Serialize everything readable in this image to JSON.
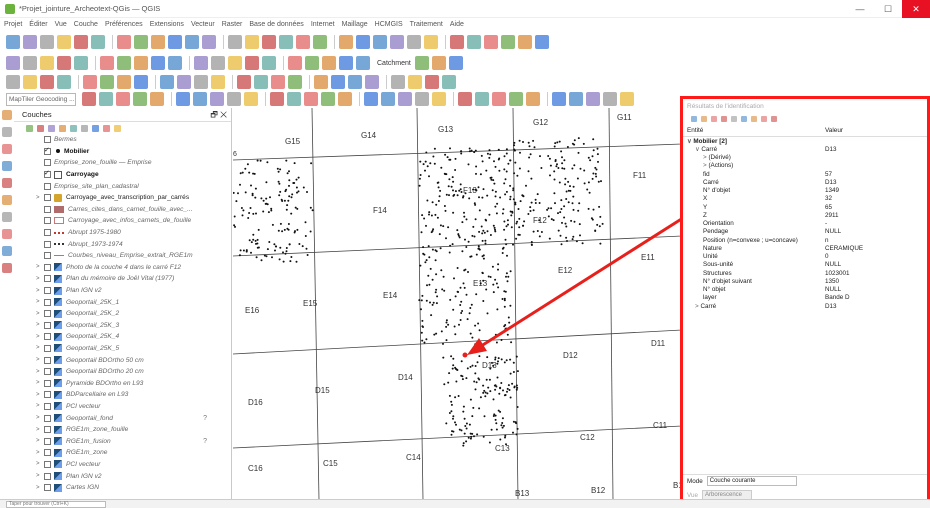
{
  "window": {
    "title": "*Projet_jointure_Archeotext-QGis — QGIS",
    "minimize": "—",
    "maximize": "☐",
    "close": "✕"
  },
  "menu": [
    "Projet",
    "Éditer",
    "Vue",
    "Couche",
    "Préférences",
    "Extensions",
    "Vecteur",
    "Raster",
    "Base de données",
    "Internet",
    "Maillage",
    "HCMGIS",
    "Traitement",
    "Aide"
  ],
  "toolbar": {
    "catchment_label": "Catchment",
    "geocoding_placeholder": "MapTiler Geocoding ..."
  },
  "layers_panel": {
    "title": "Couches",
    "dock_icon": "🗗",
    "close_icon": "✕",
    "items": [
      {
        "name": "Bermes",
        "checked": false,
        "style": "italic",
        "sym": "none"
      },
      {
        "name": "Mobilier",
        "checked": true,
        "style": "bold",
        "sym": "dot"
      },
      {
        "name": "Emprise_zone_fouille — Emprise",
        "checked": false,
        "style": "italic",
        "sym": "none"
      },
      {
        "name": "Carroyage",
        "checked": true,
        "style": "bold",
        "sym": "square"
      },
      {
        "name": "Emprise_site_plan_cadastral",
        "checked": false,
        "style": "italic",
        "sym": "none"
      },
      {
        "name": "Carroyage_avec_transcription_par_carrés",
        "checked": false,
        "style": "plain",
        "sym": "group"
      },
      {
        "name": "Carres_cites_dans_carnet_fouille_avec_...",
        "checked": false,
        "style": "italic",
        "sym": "pink"
      },
      {
        "name": "Carroyage_avec_infos_carnets_de_fouille",
        "checked": false,
        "style": "italic",
        "sym": "salmon"
      },
      {
        "name": "Abrupt 1975-1980",
        "checked": false,
        "style": "italic",
        "sym": "dash"
      },
      {
        "name": "Abrupt_1973-1974",
        "checked": false,
        "style": "italic",
        "sym": "dash2"
      },
      {
        "name": "Courbes_niveau_Emprise_extrait_RGE1m",
        "checked": false,
        "style": "italic",
        "sym": "line"
      },
      {
        "name": "Photo de la couche 4 dans le carré F12",
        "checked": false,
        "style": "italic",
        "sym": "raster"
      },
      {
        "name": "Plan du mémoire de Joël Vital (1977)",
        "checked": false,
        "style": "italic",
        "sym": "raster"
      },
      {
        "name": "Plan IGN v2",
        "checked": false,
        "style": "italic",
        "sym": "raster"
      },
      {
        "name": "Geoportail_25K_1",
        "checked": false,
        "style": "italic",
        "sym": "raster"
      },
      {
        "name": "Geoportail_25K_2",
        "checked": false,
        "style": "italic",
        "sym": "raster"
      },
      {
        "name": "Geoportail_25K_3",
        "checked": false,
        "style": "italic",
        "sym": "raster"
      },
      {
        "name": "Geoportail_25K_4",
        "checked": false,
        "style": "italic",
        "sym": "raster"
      },
      {
        "name": "Geoportail_25K_5",
        "checked": false,
        "style": "italic",
        "sym": "raster"
      },
      {
        "name": "Geoportail BDOrtho 50 cm",
        "checked": false,
        "style": "italic",
        "sym": "raster"
      },
      {
        "name": "Geoportail BDOrtho 20 cm",
        "checked": false,
        "style": "italic",
        "sym": "raster"
      },
      {
        "name": "Pyramide BDOrtho en L93",
        "checked": false,
        "style": "italic",
        "sym": "raster"
      },
      {
        "name": "BDParcellaire en L93",
        "checked": false,
        "style": "italic",
        "sym": "raster"
      },
      {
        "name": "PCI vecteur",
        "checked": false,
        "style": "italic",
        "sym": "raster"
      },
      {
        "name": "Geoportail_fond",
        "checked": false,
        "style": "italic",
        "sym": "raster",
        "q": "?"
      },
      {
        "name": "RGE1m_zone_fouille",
        "checked": false,
        "style": "italic",
        "sym": "raster"
      },
      {
        "name": "RGE1m_fusion",
        "checked": false,
        "style": "italic",
        "sym": "raster",
        "q": "?"
      },
      {
        "name": "RGE1m_zone",
        "checked": false,
        "style": "italic",
        "sym": "raster"
      },
      {
        "name": "PCI vecteur",
        "checked": false,
        "style": "italic",
        "sym": "raster"
      },
      {
        "name": "Plan IGN v2",
        "checked": false,
        "style": "italic",
        "sym": "raster"
      },
      {
        "name": "Cartes IGN",
        "checked": false,
        "style": "italic",
        "sym": "raster"
      }
    ]
  },
  "map": {
    "grid_labels": [
      "G15",
      "G14",
      "G13",
      "G12",
      "G11",
      "F14",
      "F13",
      "F12",
      "F11",
      "E16",
      "E15",
      "E14",
      "E13",
      "E12",
      "E11",
      "D16",
      "D15",
      "D14",
      "D13",
      "D12",
      "D11",
      "C16",
      "C15",
      "C14",
      "C13",
      "C12",
      "C11",
      "B13",
      "B12",
      "B1"
    ],
    "partial_label": "6",
    "point_color": "#111111",
    "arrow_color": "#e8201c"
  },
  "identify": {
    "title": "Résultats de l'identification",
    "col_entity": "Entité",
    "col_value": "Valeur",
    "rows": [
      {
        "k": "Mobilier  [2]",
        "v": "",
        "bold": true,
        "indent": 0,
        "arrow": "∨"
      },
      {
        "k": "Carré",
        "v": "D13",
        "indent": 1,
        "arrow": "∨"
      },
      {
        "k": "(Dérivé)",
        "v": "",
        "indent": 2,
        "arrow": ">"
      },
      {
        "k": "(Actions)",
        "v": "",
        "indent": 2,
        "arrow": ">"
      },
      {
        "k": "fid",
        "v": "57",
        "indent": 2
      },
      {
        "k": "Carré",
        "v": "D13",
        "indent": 2
      },
      {
        "k": "N° d'objet",
        "v": "1349",
        "indent": 2
      },
      {
        "k": "X",
        "v": "32",
        "indent": 2
      },
      {
        "k": "Y",
        "v": "65",
        "indent": 2
      },
      {
        "k": "Z",
        "v": "2911",
        "indent": 2
      },
      {
        "k": "Orientation",
        "v": "-",
        "indent": 2
      },
      {
        "k": "Pendage",
        "v": "NULL",
        "indent": 2
      },
      {
        "k": "Position (n=convexe ; u=concave)",
        "v": "n",
        "indent": 2
      },
      {
        "k": "Nature",
        "v": "CERAMIQUE",
        "indent": 2
      },
      {
        "k": "Unité",
        "v": "0",
        "indent": 2
      },
      {
        "k": "Sous-unité",
        "v": "NULL",
        "indent": 2
      },
      {
        "k": "Structures",
        "v": "1023001",
        "indent": 2
      },
      {
        "k": "N° d'objet suivant",
        "v": "1350",
        "indent": 2
      },
      {
        "k": "N° objet",
        "v": "NULL",
        "indent": 2
      },
      {
        "k": "layer",
        "v": "Bande D",
        "indent": 2
      },
      {
        "k": "Carré",
        "v": "D13",
        "indent": 1,
        "arrow": ">"
      }
    ],
    "mode_label": "Mode",
    "mode_value": "Couche courante",
    "vue_label": "Vue",
    "vue_value": "Arborescence",
    "border_color": "#ff1a1a"
  },
  "statusbar": {
    "search_placeholder": "Taper pour trouver (Ctrl+K)"
  }
}
